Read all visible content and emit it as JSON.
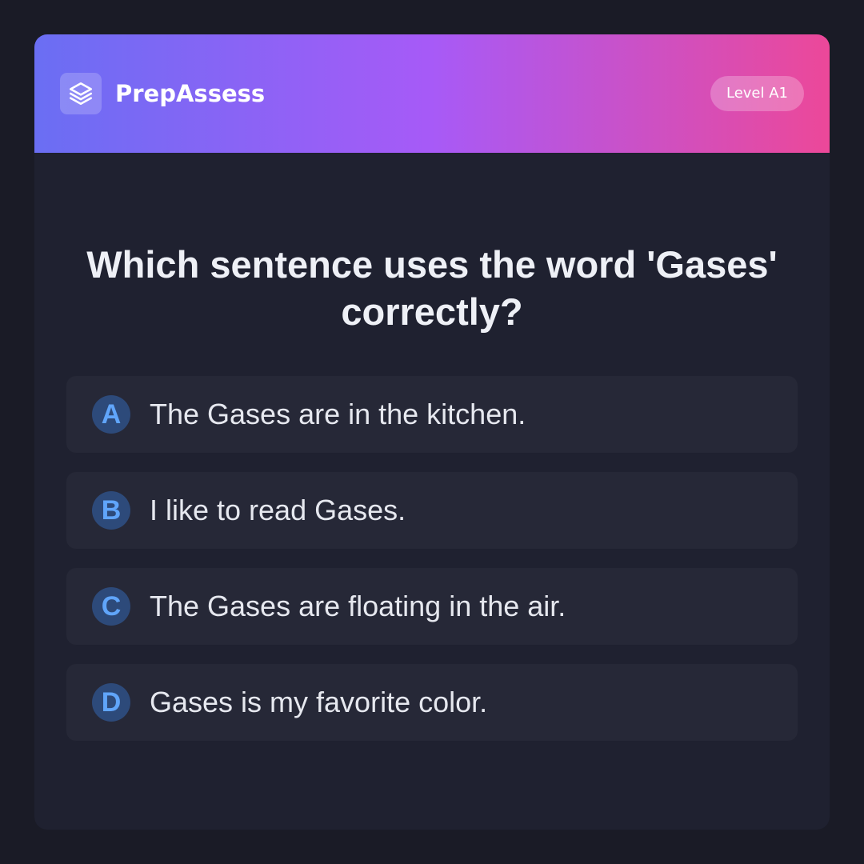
{
  "header": {
    "brand": "PrepAssess",
    "logo_icon": "layers-icon",
    "level_badge": "Level A1"
  },
  "question": {
    "text": "Which sentence uses the word 'Gases' correctly?"
  },
  "options": [
    {
      "letter": "A",
      "text": "The Gases are in the kitchen."
    },
    {
      "letter": "B",
      "text": "I like to read Gases."
    },
    {
      "letter": "C",
      "text": "The Gases are floating in the air."
    },
    {
      "letter": "D",
      "text": "Gases is my favorite color."
    }
  ],
  "colors": {
    "background": "#1a1b26",
    "card": "#1f2130",
    "option_bg": "#262837",
    "gradient_start": "#6a6ef3",
    "gradient_mid": "#a75af7",
    "gradient_end": "#ec4899",
    "letter_circle": "#2d4a7a",
    "letter_text": "#60a5fa"
  }
}
